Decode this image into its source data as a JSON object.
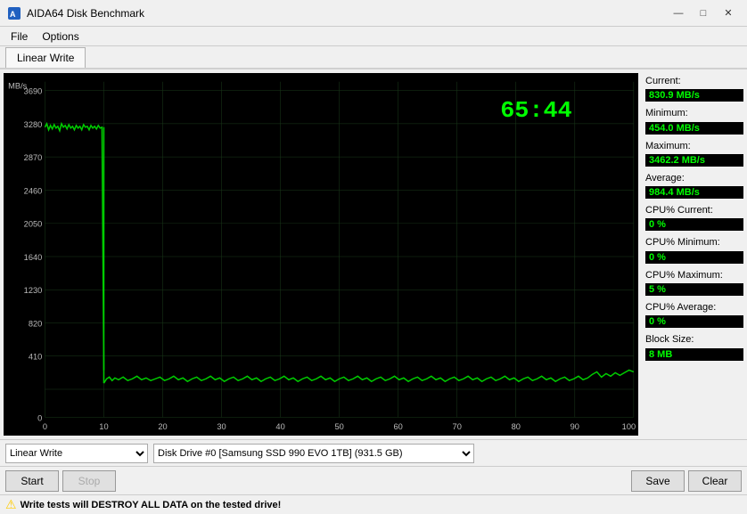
{
  "window": {
    "title": "AIDA64 Disk Benchmark",
    "controls": {
      "minimize": "—",
      "maximize": "□",
      "close": "✕"
    }
  },
  "menu": {
    "items": [
      "File",
      "Options"
    ]
  },
  "tab": {
    "label": "Linear Write"
  },
  "chart": {
    "timer": "65:44",
    "y_axis_label": "MB/s",
    "y_labels": [
      "3690",
      "3280",
      "2870",
      "2460",
      "2050",
      "1640",
      "1230",
      "820",
      "410",
      "0"
    ],
    "x_labels": [
      "0",
      "10",
      "20",
      "30",
      "40",
      "50",
      "60",
      "70",
      "80",
      "90",
      "100 %"
    ]
  },
  "stats": {
    "current_label": "Current:",
    "current_value": "830.9 MB/s",
    "minimum_label": "Minimum:",
    "minimum_value": "454.0 MB/s",
    "maximum_label": "Maximum:",
    "maximum_value": "3462.2 MB/s",
    "average_label": "Average:",
    "average_value": "984.4 MB/s",
    "cpu_current_label": "CPU% Current:",
    "cpu_current_value": "0 %",
    "cpu_minimum_label": "CPU% Minimum:",
    "cpu_minimum_value": "0 %",
    "cpu_maximum_label": "CPU% Maximum:",
    "cpu_maximum_value": "5 %",
    "cpu_average_label": "CPU% Average:",
    "cpu_average_value": "0 %",
    "block_size_label": "Block Size:",
    "block_size_value": "8 MB"
  },
  "bottom_bar": {
    "test_type": "Linear Write",
    "drive_label": "Disk Drive #0  [Samsung SSD 990 EVO 1TB]  (931.5 GB)"
  },
  "actions": {
    "start": "Start",
    "stop": "Stop",
    "save": "Save",
    "clear": "Clear"
  },
  "warning": {
    "text": "Write tests will DESTROY ALL DATA on the tested drive!"
  }
}
